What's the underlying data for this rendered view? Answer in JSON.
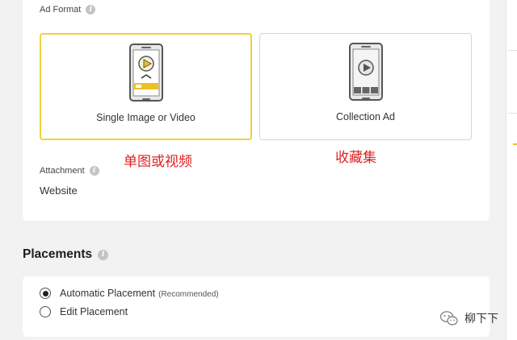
{
  "ad_format": {
    "label": "Ad Format",
    "options": [
      {
        "label": "Single Image or Video",
        "selected": true
      },
      {
        "label": "Collection Ad",
        "selected": false
      }
    ]
  },
  "annotations": {
    "single": "单图或视频",
    "collection": "收藏集"
  },
  "attachment": {
    "label": "Attachment",
    "value": "Website"
  },
  "placements": {
    "title": "Placements",
    "options": [
      {
        "label": "Automatic Placement",
        "note": "(Recommended)",
        "selected": true
      },
      {
        "label": "Edit Placement",
        "selected": false
      }
    ]
  },
  "watermark": {
    "text": "柳下下"
  },
  "colors": {
    "accent": "#f0d13c",
    "annotation": "#e02020",
    "background": "#f2f2f2",
    "card": "#ffffff"
  },
  "icons": [
    "info-icon",
    "phone-video-icon",
    "phone-collection-icon",
    "wechat-icon"
  ]
}
